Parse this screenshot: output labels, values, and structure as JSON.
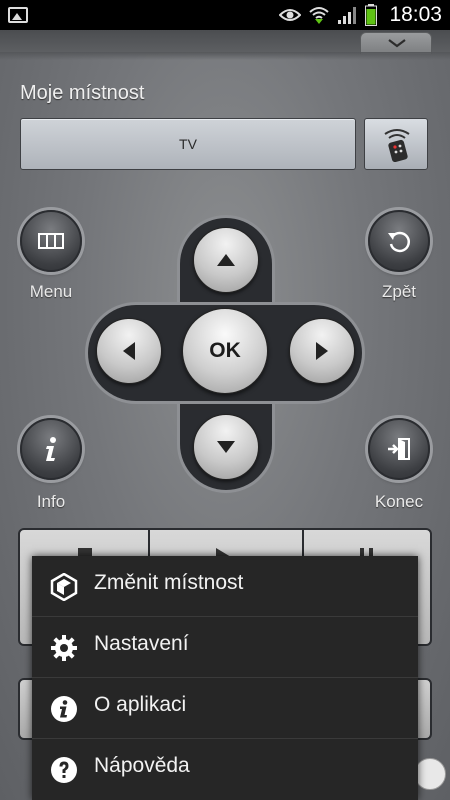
{
  "status_bar": {
    "time": "18:03",
    "icons": [
      "image-icon",
      "eye-icon",
      "wifi-icon",
      "signal-icon",
      "battery-icon"
    ]
  },
  "remote": {
    "room_title": "Moje místnost",
    "device_name": "TV",
    "menu_label": "Menu",
    "back_label": "Zpět",
    "info_label": "Info",
    "exit_label": "Konec",
    "ok_label": "OK"
  },
  "popup_menu": {
    "items": [
      {
        "label": "Změnit místnost",
        "icon": "house-icon"
      },
      {
        "label": "Nastavení",
        "icon": "gear-icon"
      },
      {
        "label": "O aplikaci",
        "icon": "info-icon"
      },
      {
        "label": "Nápověda",
        "icon": "help-icon"
      }
    ]
  },
  "colors": {
    "accent_green": "#5fc314",
    "panel_gray": "#74767a",
    "popup_bg": "#262626"
  }
}
